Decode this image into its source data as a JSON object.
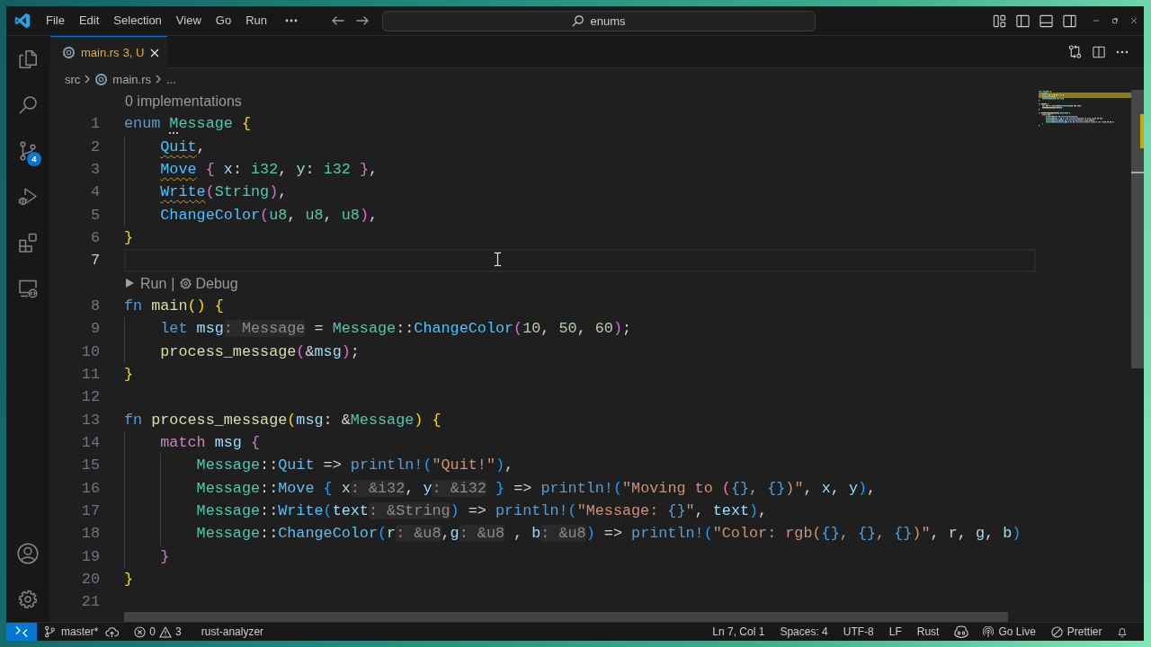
{
  "title_bar": {
    "menu": [
      "File",
      "Edit",
      "Selection",
      "View",
      "Go",
      "Run"
    ],
    "command_center": {
      "label": "enums"
    }
  },
  "activity_bar": {
    "source_control_badge": "4"
  },
  "tabs": [
    {
      "label": "main.rs",
      "status": "3, U",
      "selected": true
    }
  ],
  "breadcrumbs": [
    {
      "kind": "folder",
      "text": "src"
    },
    {
      "kind": "file",
      "text": "main.rs"
    },
    {
      "kind": "symbol",
      "text": "..."
    }
  ],
  "editor": {
    "rows": [
      {
        "kind": "lens_info",
        "text": "0 implementations"
      },
      {
        "kind": "code",
        "number": "1",
        "current": false,
        "tokens": [
          {
            "text": "enum ",
            "kind": "kw"
          },
          {
            "text": "M",
            "kind": "type_dotted"
          },
          {
            "text": "essage",
            "kind": "type"
          },
          {
            "text": " {",
            "kind": "b1"
          }
        ],
        "children": [
          {
            "kind": "code",
            "number": "2",
            "current": false,
            "tokens": [
              {
                "text": "Quit",
                "kind": "member_warn"
              },
              {
                "text": ",",
                "kind": "op"
              }
            ]
          },
          {
            "kind": "code",
            "number": "3",
            "current": false,
            "tokens": [
              {
                "text": "Move",
                "kind": "member_warn"
              },
              {
                "text": " {",
                "kind": "b2"
              },
              {
                "text": " x",
                "kind": "var"
              },
              {
                "text": ": ",
                "kind": "op"
              },
              {
                "text": "i32",
                "kind": "type"
              },
              {
                "text": ", ",
                "kind": "op"
              },
              {
                "text": "y",
                "kind": "var"
              },
              {
                "text": ": ",
                "kind": "op"
              },
              {
                "text": "i32",
                "kind": "type"
              },
              {
                "text": " }",
                "kind": "b2"
              },
              {
                "text": ",",
                "kind": "op"
              }
            ]
          },
          {
            "kind": "code",
            "number": "4",
            "current": false,
            "tokens": [
              {
                "text": "Write",
                "kind": "member_warn"
              },
              {
                "text": "(",
                "kind": "b2"
              },
              {
                "text": "String",
                "kind": "type"
              },
              {
                "text": ")",
                "kind": "b2"
              },
              {
                "text": ",",
                "kind": "op"
              }
            ]
          },
          {
            "kind": "code",
            "number": "5",
            "current": false,
            "tokens": [
              {
                "text": "ChangeColor",
                "kind": "member"
              },
              {
                "text": "(",
                "kind": "b2"
              },
              {
                "text": "u8",
                "kind": "type"
              },
              {
                "text": ", ",
                "kind": "op"
              },
              {
                "text": "u8",
                "kind": "type"
              },
              {
                "text": ", ",
                "kind": "op"
              },
              {
                "text": "u8",
                "kind": "type"
              },
              {
                "text": ")",
                "kind": "b2"
              },
              {
                "text": ",",
                "kind": "op"
              }
            ]
          }
        ]
      },
      {
        "kind": "code",
        "number": "6",
        "current": false,
        "tokens": [
          {
            "text": "}",
            "kind": "b1"
          }
        ]
      },
      {
        "kind": "code",
        "number": "7",
        "current": true
      },
      {
        "kind": "lens_run",
        "run": "Run",
        "separator": "|",
        "debug": "Debug"
      },
      {
        "kind": "code",
        "number": "8",
        "current": false,
        "tokens": [
          {
            "text": "fn ",
            "kind": "kw"
          },
          {
            "text": "main",
            "kind": "fn"
          },
          {
            "text": "() {",
            "kind": "b1"
          }
        ],
        "children": [
          {
            "kind": "code",
            "number": "9",
            "current": false,
            "tokens": [
              {
                "text": "let ",
                "kind": "kw"
              },
              {
                "text": "msg",
                "kind": "var"
              },
              {
                "text": ": Message",
                "kind": "hint"
              },
              {
                "text": " = ",
                "kind": "op"
              },
              {
                "text": "Message",
                "kind": "type"
              },
              {
                "text": "::",
                "kind": "op"
              },
              {
                "text": "ChangeColor",
                "kind": "member"
              },
              {
                "text": "(",
                "kind": "b2"
              },
              {
                "text": "10",
                "kind": "num"
              },
              {
                "text": ", ",
                "kind": "op"
              },
              {
                "text": "50",
                "kind": "num"
              },
              {
                "text": ", ",
                "kind": "op"
              },
              {
                "text": "60",
                "kind": "num"
              },
              {
                "text": ")",
                "kind": "b2"
              },
              {
                "text": ";",
                "kind": "op"
              }
            ]
          },
          {
            "kind": "code",
            "number": "10",
            "current": false,
            "tokens": [
              {
                "text": "process_message",
                "kind": "fn"
              },
              {
                "text": "(",
                "kind": "b2"
              },
              {
                "text": "&",
                "kind": "op"
              },
              {
                "text": "msg",
                "kind": "var"
              },
              {
                "text": ")",
                "kind": "b2"
              },
              {
                "text": ";",
                "kind": "op"
              }
            ]
          }
        ]
      },
      {
        "kind": "code",
        "number": "11",
        "current": false,
        "tokens": [
          {
            "text": "}",
            "kind": "b1"
          }
        ]
      },
      {
        "kind": "code",
        "number": "12",
        "current": false
      },
      {
        "kind": "code",
        "number": "13",
        "current": false,
        "tokens": [
          {
            "text": "fn ",
            "kind": "kw"
          },
          {
            "text": "process_message",
            "kind": "fn"
          },
          {
            "text": "(",
            "kind": "b1"
          },
          {
            "text": "msg",
            "kind": "var"
          },
          {
            "text": ": &",
            "kind": "op"
          },
          {
            "text": "Message",
            "kind": "type"
          },
          {
            "text": ") {",
            "kind": "b1"
          }
        ],
        "children": [
          {
            "kind": "code",
            "number": "14",
            "current": false,
            "tokens": [
              {
                "text": "match ",
                "kind": "ctrl"
              },
              {
                "text": "msg",
                "kind": "var"
              },
              {
                "text": " {",
                "kind": "b2"
              }
            ],
            "children": [
              {
                "kind": "code",
                "number": "15",
                "current": false,
                "tokens": [
                  {
                    "text": "Message",
                    "kind": "type"
                  },
                  {
                    "text": "::",
                    "kind": "op"
                  },
                  {
                    "text": "Quit",
                    "kind": "member"
                  },
                  {
                    "text": " => ",
                    "kind": "op"
                  },
                  {
                    "text": "println!",
                    "kind": "macro"
                  },
                  {
                    "text": "(",
                    "kind": "b3"
                  },
                  {
                    "text": "\"Quit!\"",
                    "kind": "str"
                  },
                  {
                    "text": ")",
                    "kind": "b3"
                  },
                  {
                    "text": ",",
                    "kind": "op"
                  }
                ]
              },
              {
                "kind": "code",
                "number": "16",
                "current": false,
                "tokens": [
                  {
                    "text": "Message",
                    "kind": "type"
                  },
                  {
                    "text": "::",
                    "kind": "op"
                  },
                  {
                    "text": "Move",
                    "kind": "member"
                  },
                  {
                    "text": " { ",
                    "kind": "b3"
                  },
                  {
                    "text": "x",
                    "kind": "var"
                  },
                  {
                    "text": ": &i32",
                    "kind": "hint"
                  },
                  {
                    "text": ", ",
                    "kind": "op"
                  },
                  {
                    "text": "y",
                    "kind": "var"
                  },
                  {
                    "text": ": &i32",
                    "kind": "hint"
                  },
                  {
                    "text": " }",
                    "kind": "b3"
                  },
                  {
                    "text": " => ",
                    "kind": "op"
                  },
                  {
                    "text": "println!",
                    "kind": "macro"
                  },
                  {
                    "text": "(",
                    "kind": "b3"
                  },
                  {
                    "text": "\"Moving to (",
                    "kind": "str"
                  },
                  {
                    "text": "{}",
                    "kind": "fmt"
                  },
                  {
                    "text": ", ",
                    "kind": "str"
                  },
                  {
                    "text": "{}",
                    "kind": "fmt"
                  },
                  {
                    "text": ")\"",
                    "kind": "str"
                  },
                  {
                    "text": ", ",
                    "kind": "op"
                  },
                  {
                    "text": "x",
                    "kind": "var"
                  },
                  {
                    "text": ", ",
                    "kind": "op"
                  },
                  {
                    "text": "y",
                    "kind": "var"
                  },
                  {
                    "text": ")",
                    "kind": "b3"
                  },
                  {
                    "text": ",",
                    "kind": "op"
                  }
                ]
              },
              {
                "kind": "code",
                "number": "17",
                "current": false,
                "tokens": [
                  {
                    "text": "Message",
                    "kind": "type"
                  },
                  {
                    "text": "::",
                    "kind": "op"
                  },
                  {
                    "text": "Write",
                    "kind": "member"
                  },
                  {
                    "text": "(",
                    "kind": "b3"
                  },
                  {
                    "text": "text",
                    "kind": "var"
                  },
                  {
                    "text": ": &String",
                    "kind": "hint"
                  },
                  {
                    "text": ")",
                    "kind": "b3"
                  },
                  {
                    "text": " => ",
                    "kind": "op"
                  },
                  {
                    "text": "println!",
                    "kind": "macro"
                  },
                  {
                    "text": "(",
                    "kind": "b3"
                  },
                  {
                    "text": "\"Message: ",
                    "kind": "str"
                  },
                  {
                    "text": "{}",
                    "kind": "fmt"
                  },
                  {
                    "text": "\"",
                    "kind": "str"
                  },
                  {
                    "text": ", ",
                    "kind": "op"
                  },
                  {
                    "text": "text",
                    "kind": "var"
                  },
                  {
                    "text": ")",
                    "kind": "b3"
                  },
                  {
                    "text": ",",
                    "kind": "op"
                  }
                ]
              },
              {
                "kind": "code",
                "number": "18",
                "current": false,
                "tokens": [
                  {
                    "text": "Message",
                    "kind": "type"
                  },
                  {
                    "text": "::",
                    "kind": "op"
                  },
                  {
                    "text": "ChangeColor",
                    "kind": "member"
                  },
                  {
                    "text": "(",
                    "kind": "b3"
                  },
                  {
                    "text": "r",
                    "kind": "var"
                  },
                  {
                    "text": ": &u8",
                    "kind": "hint"
                  },
                  {
                    "text": ",",
                    "kind": "op"
                  },
                  {
                    "text": "g",
                    "kind": "var"
                  },
                  {
                    "text": ": &u8",
                    "kind": "hint"
                  },
                  {
                    "text": " , ",
                    "kind": "op"
                  },
                  {
                    "text": "b",
                    "kind": "var"
                  },
                  {
                    "text": ": &u8",
                    "kind": "hint"
                  },
                  {
                    "text": ")",
                    "kind": "b3"
                  },
                  {
                    "text": " => ",
                    "kind": "op"
                  },
                  {
                    "text": "println!",
                    "kind": "macro"
                  },
                  {
                    "text": "(",
                    "kind": "b3"
                  },
                  {
                    "text": "\"Color: rgb(",
                    "kind": "str"
                  },
                  {
                    "text": "{}",
                    "kind": "fmt"
                  },
                  {
                    "text": ", ",
                    "kind": "str"
                  },
                  {
                    "text": "{}",
                    "kind": "fmt"
                  },
                  {
                    "text": ", ",
                    "kind": "str"
                  },
                  {
                    "text": "{}",
                    "kind": "fmt"
                  },
                  {
                    "text": ")\"",
                    "kind": "str"
                  },
                  {
                    "text": ", ",
                    "kind": "op"
                  },
                  {
                    "text": "r",
                    "kind": "var"
                  },
                  {
                    "text": ", ",
                    "kind": "op"
                  },
                  {
                    "text": "g",
                    "kind": "var"
                  },
                  {
                    "text": ", ",
                    "kind": "op"
                  },
                  {
                    "text": "b",
                    "kind": "var"
                  },
                  {
                    "text": ")",
                    "kind": "b3"
                  }
                ]
              }
            ]
          },
          {
            "kind": "code",
            "number": "19",
            "current": false,
            "tokens": [
              {
                "text": "}",
                "kind": "b2"
              }
            ]
          }
        ]
      },
      {
        "kind": "code",
        "number": "20",
        "current": false,
        "tokens": [
          {
            "text": "}",
            "kind": "b1"
          }
        ]
      },
      {
        "kind": "code",
        "number": "21",
        "current": false
      }
    ]
  },
  "status_bar": {
    "branch": "master*",
    "errors": "0",
    "warnings": "3",
    "language_server": "rust-analyzer",
    "cursor_position": "Ln 7, Col 1",
    "indentation": "Spaces: 4",
    "encoding": "UTF-8",
    "line_ending": "LF",
    "language": "Rust",
    "live_server": "Go Live",
    "formatter": "Prettier"
  }
}
